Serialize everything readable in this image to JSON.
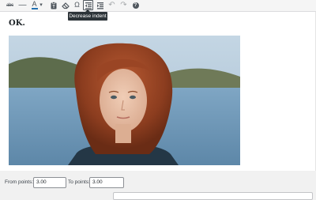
{
  "toolbar": {
    "buttons": [
      {
        "name": "strikethrough-button",
        "icon": "strikethrough-icon",
        "glyph": "abc"
      },
      {
        "name": "horizontal-line-button",
        "icon": "horizontal-line-icon",
        "glyph": "—"
      },
      {
        "name": "text-color-button",
        "icon": "text-color-icon",
        "glyph": "A"
      },
      {
        "name": "text-color-dropdown",
        "icon": "caret-down-icon",
        "glyph": "▾"
      },
      {
        "name": "paste-as-text-button",
        "icon": "clipboard-icon",
        "glyph": ""
      },
      {
        "name": "clear-formatting-button",
        "icon": "eraser-icon",
        "glyph": ""
      },
      {
        "name": "special-character-button",
        "icon": "omega-icon",
        "glyph": "Ω"
      },
      {
        "name": "decrease-indent-button",
        "icon": "outdent-icon",
        "glyph": ""
      },
      {
        "name": "increase-indent-button",
        "icon": "indent-icon",
        "glyph": ""
      },
      {
        "name": "undo-button",
        "icon": "undo-icon",
        "glyph": "↶"
      },
      {
        "name": "redo-button",
        "icon": "redo-icon",
        "glyph": "↷"
      },
      {
        "name": "help-button",
        "icon": "help-icon",
        "glyph": "?"
      }
    ],
    "active_button": "decrease-indent-button",
    "tooltip": "Decrease indent",
    "accent_color": "#50575e",
    "text_color_swatch": "#2271b1"
  },
  "editor": {
    "content_text": "OK.",
    "image": {
      "subject": "portrait-photo-woman-red-hair",
      "background": "lake-and-hills"
    }
  },
  "bottom": {
    "from_label": "From points:",
    "from_value": "3.00",
    "to_label": "To points:",
    "to_value": "3.00"
  }
}
